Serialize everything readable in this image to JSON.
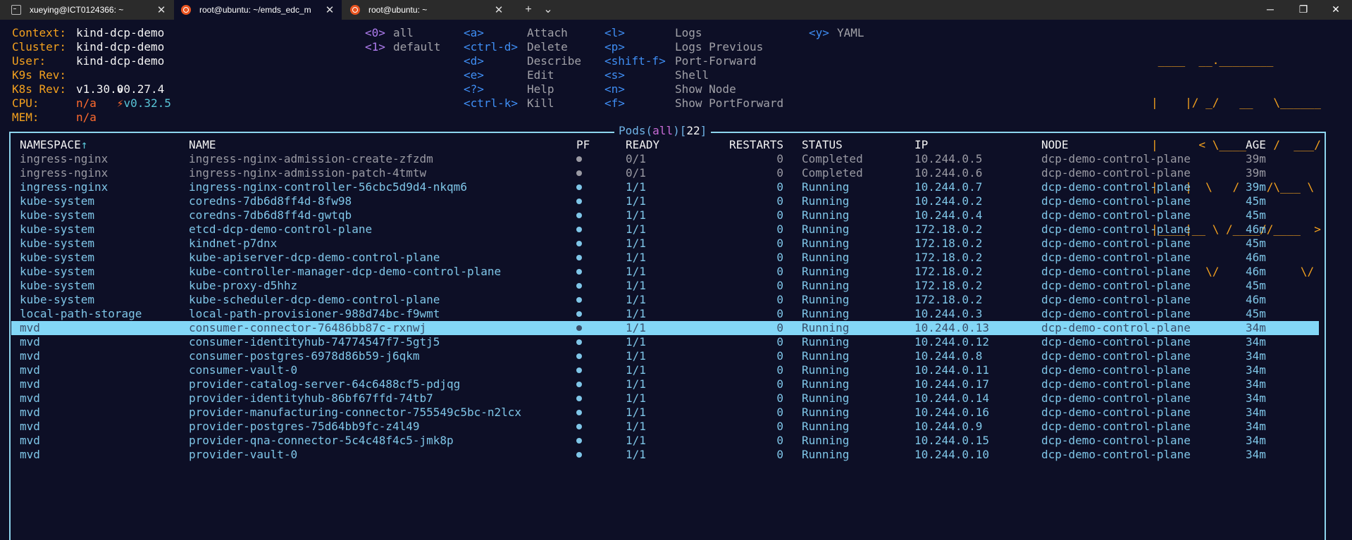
{
  "tabs": [
    {
      "title": "xueying@ICT0124366: ~",
      "icon": "terminal-icon",
      "active": false
    },
    {
      "title": "root@ubuntu: ~/emds_edc_m",
      "icon": "ubuntu-icon",
      "active": true
    },
    {
      "title": "root@ubuntu: ~",
      "icon": "ubuntu-icon",
      "active": false
    }
  ],
  "tabbar": {
    "new_tab": "+",
    "dropdown": "⌄",
    "close": "✕"
  },
  "window": {
    "minimize": "─",
    "maximize": "❐",
    "close": "✕"
  },
  "info": {
    "context_label": "Context:",
    "context_value": "kind-dcp-demo",
    "cluster_label": "Cluster:",
    "cluster_value": "kind-dcp-demo",
    "user_label": "User:",
    "user_value": "kind-dcp-demo",
    "k9s_label": "K9s Rev:",
    "k9s_value": "v0.27.4",
    "k9s_update": "v0.32.5",
    "k8s_label": "K8s Rev:",
    "k8s_value": "v1.30.0",
    "cpu_label": "CPU:",
    "cpu_value": "n/a",
    "mem_label": "MEM:",
    "mem_value": "n/a"
  },
  "namespaces": [
    {
      "key": "<0>",
      "label": "all"
    },
    {
      "key": "<1>",
      "label": "default"
    }
  ],
  "shortcuts_col1": [
    {
      "key": "<a>",
      "label": "Attach"
    },
    {
      "key": "<ctrl-d>",
      "label": "Delete"
    },
    {
      "key": "<d>",
      "label": "Describe"
    },
    {
      "key": "<e>",
      "label": "Edit"
    },
    {
      "key": "<?>",
      "label": "Help"
    },
    {
      "key": "<ctrl-k>",
      "label": "Kill"
    }
  ],
  "shortcuts_col2": [
    {
      "key": "<l>",
      "label": "Logs"
    },
    {
      "key": "<p>",
      "label": "Logs Previous"
    },
    {
      "key": "<shift-f>",
      "label": "Port-Forward"
    },
    {
      "key": "<s>",
      "label": "Shell"
    },
    {
      "key": "<n>",
      "label": "Show Node"
    },
    {
      "key": "<f>",
      "label": "Show PortForward"
    }
  ],
  "shortcuts_col3": [
    {
      "key": "<y>",
      "label": "YAML"
    }
  ],
  "logo_lines": [
    " ____  __.________       ",
    "|    |/ _/   __   \\______",
    "|      < \\____    /  ___/",
    "|    |  \\   /    /\\___ \\ ",
    "|____|__ \\ /____//____  >",
    "        \\/            \\/ "
  ],
  "view": {
    "resource": "Pods",
    "open": "(",
    "scope": "all",
    "close": ")",
    "count_open": "[",
    "count": "22",
    "count_close": "]"
  },
  "columns": {
    "namespace": "NAMESPACE",
    "sort_arrow": "↑",
    "name": "NAME",
    "pf": "PF",
    "ready": "READY",
    "restarts": "RESTARTS",
    "status": "STATUS",
    "ip": "IP",
    "node": "NODE",
    "age": "AGE"
  },
  "pods": [
    {
      "namespace": "ingress-nginx",
      "name": "ingress-nginx-admission-create-zfzdm",
      "ready": "0/1",
      "restarts": "0",
      "status": "Completed",
      "ip": "10.244.0.5",
      "node": "dcp-demo-control-plane",
      "age": "39m",
      "dim": true
    },
    {
      "namespace": "ingress-nginx",
      "name": "ingress-nginx-admission-patch-4tmtw",
      "ready": "0/1",
      "restarts": "0",
      "status": "Completed",
      "ip": "10.244.0.6",
      "node": "dcp-demo-control-plane",
      "age": "39m",
      "dim": true
    },
    {
      "namespace": "ingress-nginx",
      "name": "ingress-nginx-controller-56cbc5d9d4-nkqm6",
      "ready": "1/1",
      "restarts": "0",
      "status": "Running",
      "ip": "10.244.0.7",
      "node": "dcp-demo-control-plane",
      "age": "39m"
    },
    {
      "namespace": "kube-system",
      "name": "coredns-7db6d8ff4d-8fw98",
      "ready": "1/1",
      "restarts": "0",
      "status": "Running",
      "ip": "10.244.0.2",
      "node": "dcp-demo-control-plane",
      "age": "45m"
    },
    {
      "namespace": "kube-system",
      "name": "coredns-7db6d8ff4d-gwtqb",
      "ready": "1/1",
      "restarts": "0",
      "status": "Running",
      "ip": "10.244.0.4",
      "node": "dcp-demo-control-plane",
      "age": "45m"
    },
    {
      "namespace": "kube-system",
      "name": "etcd-dcp-demo-control-plane",
      "ready": "1/1",
      "restarts": "0",
      "status": "Running",
      "ip": "172.18.0.2",
      "node": "dcp-demo-control-plane",
      "age": "46m"
    },
    {
      "namespace": "kube-system",
      "name": "kindnet-p7dnx",
      "ready": "1/1",
      "restarts": "0",
      "status": "Running",
      "ip": "172.18.0.2",
      "node": "dcp-demo-control-plane",
      "age": "45m"
    },
    {
      "namespace": "kube-system",
      "name": "kube-apiserver-dcp-demo-control-plane",
      "ready": "1/1",
      "restarts": "0",
      "status": "Running",
      "ip": "172.18.0.2",
      "node": "dcp-demo-control-plane",
      "age": "46m"
    },
    {
      "namespace": "kube-system",
      "name": "kube-controller-manager-dcp-demo-control-plane",
      "ready": "1/1",
      "restarts": "0",
      "status": "Running",
      "ip": "172.18.0.2",
      "node": "dcp-demo-control-plane",
      "age": "46m"
    },
    {
      "namespace": "kube-system",
      "name": "kube-proxy-d5hhz",
      "ready": "1/1",
      "restarts": "0",
      "status": "Running",
      "ip": "172.18.0.2",
      "node": "dcp-demo-control-plane",
      "age": "45m"
    },
    {
      "namespace": "kube-system",
      "name": "kube-scheduler-dcp-demo-control-plane",
      "ready": "1/1",
      "restarts": "0",
      "status": "Running",
      "ip": "172.18.0.2",
      "node": "dcp-demo-control-plane",
      "age": "46m"
    },
    {
      "namespace": "local-path-storage",
      "name": "local-path-provisioner-988d74bc-f9wmt",
      "ready": "1/1",
      "restarts": "0",
      "status": "Running",
      "ip": "10.244.0.3",
      "node": "dcp-demo-control-plane",
      "age": "45m"
    },
    {
      "namespace": "mvd",
      "name": "consumer-connector-76486bb87c-rxnwj",
      "ready": "1/1",
      "restarts": "0",
      "status": "Running",
      "ip": "10.244.0.13",
      "node": "dcp-demo-control-plane",
      "age": "34m",
      "selected": true
    },
    {
      "namespace": "mvd",
      "name": "consumer-identityhub-74774547f7-5gtj5",
      "ready": "1/1",
      "restarts": "0",
      "status": "Running",
      "ip": "10.244.0.12",
      "node": "dcp-demo-control-plane",
      "age": "34m"
    },
    {
      "namespace": "mvd",
      "name": "consumer-postgres-6978d86b59-j6qkm",
      "ready": "1/1",
      "restarts": "0",
      "status": "Running",
      "ip": "10.244.0.8",
      "node": "dcp-demo-control-plane",
      "age": "34m"
    },
    {
      "namespace": "mvd",
      "name": "consumer-vault-0",
      "ready": "1/1",
      "restarts": "0",
      "status": "Running",
      "ip": "10.244.0.11",
      "node": "dcp-demo-control-plane",
      "age": "34m"
    },
    {
      "namespace": "mvd",
      "name": "provider-catalog-server-64c6488cf5-pdjqg",
      "ready": "1/1",
      "restarts": "0",
      "status": "Running",
      "ip": "10.244.0.17",
      "node": "dcp-demo-control-plane",
      "age": "34m"
    },
    {
      "namespace": "mvd",
      "name": "provider-identityhub-86bf67ffd-74tb7",
      "ready": "1/1",
      "restarts": "0",
      "status": "Running",
      "ip": "10.244.0.14",
      "node": "dcp-demo-control-plane",
      "age": "34m"
    },
    {
      "namespace": "mvd",
      "name": "provider-manufacturing-connector-755549c5bc-n2lcx",
      "ready": "1/1",
      "restarts": "0",
      "status": "Running",
      "ip": "10.244.0.16",
      "node": "dcp-demo-control-plane",
      "age": "34m"
    },
    {
      "namespace": "mvd",
      "name": "provider-postgres-75d64bb9fc-z4l49",
      "ready": "1/1",
      "restarts": "0",
      "status": "Running",
      "ip": "10.244.0.9",
      "node": "dcp-demo-control-plane",
      "age": "34m"
    },
    {
      "namespace": "mvd",
      "name": "provider-qna-connector-5c4c48f4c5-jmk8p",
      "ready": "1/1",
      "restarts": "0",
      "status": "Running",
      "ip": "10.244.0.15",
      "node": "dcp-demo-control-plane",
      "age": "34m"
    },
    {
      "namespace": "mvd",
      "name": "provider-vault-0",
      "ready": "1/1",
      "restarts": "0",
      "status": "Running",
      "ip": "10.244.0.10",
      "node": "dcp-demo-control-plane",
      "age": "34m"
    }
  ]
}
